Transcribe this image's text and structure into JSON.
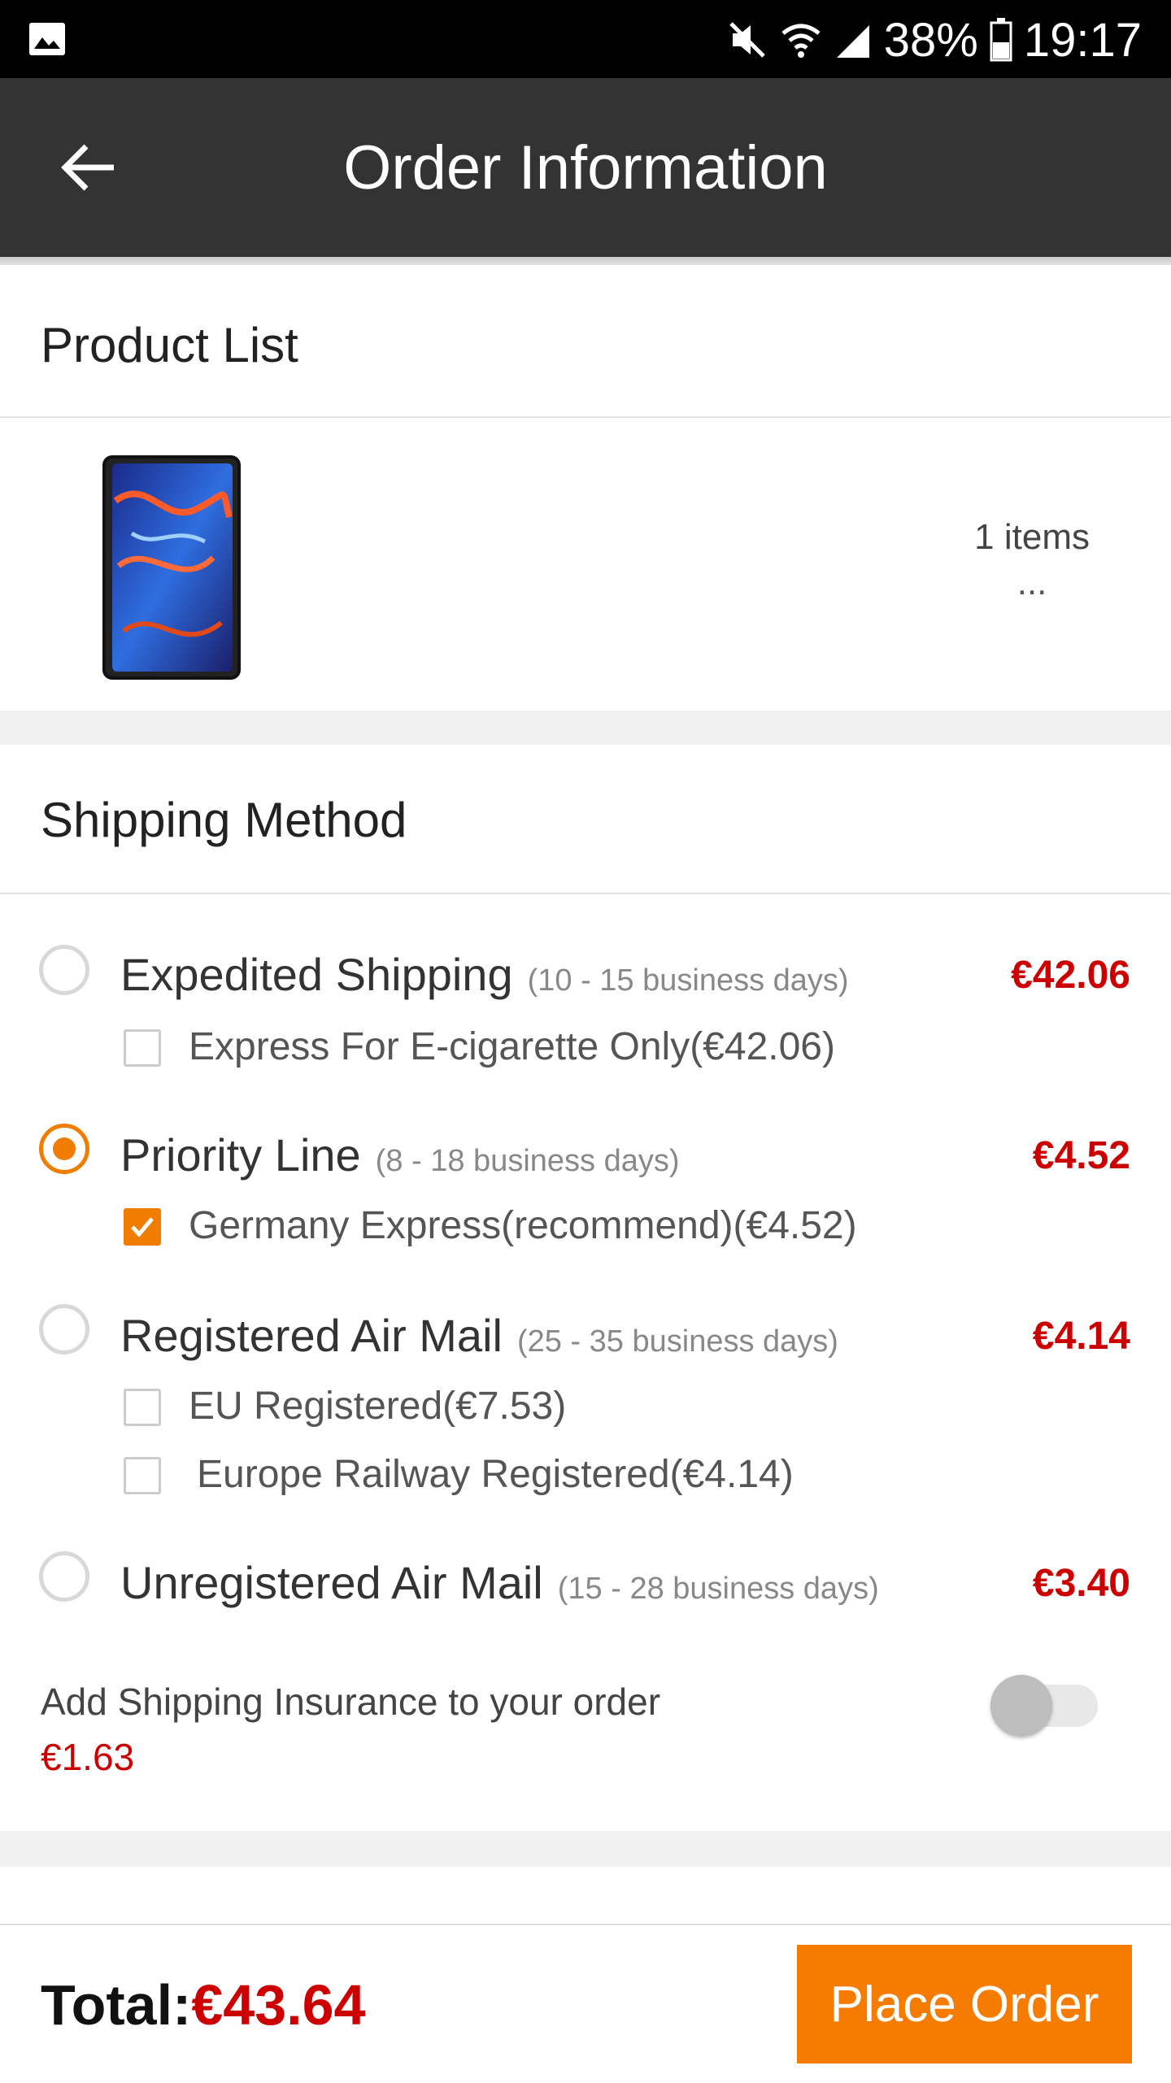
{
  "status_bar": {
    "battery": "38%",
    "time": "19:17",
    "icons": [
      "gallery-icon",
      "mute-icon",
      "wifi-icon",
      "signal-icon",
      "battery-icon"
    ]
  },
  "app_bar": {
    "title": "Order Information",
    "back_icon": "arrow-left-icon"
  },
  "product_list": {
    "title": "Product List",
    "items_count": "1 items",
    "more": "..."
  },
  "shipping": {
    "title": "Shipping Method",
    "options": [
      {
        "name": "Expedited Shipping",
        "days": "(10 - 15 business days)",
        "price": "€42.06",
        "selected": false,
        "sub_options": [
          {
            "label": "Express For E-cigarette Only(€42.06)",
            "checked": false
          }
        ]
      },
      {
        "name": "Priority Line",
        "days": "(8 - 18 business days)",
        "price": "€4.52",
        "selected": true,
        "sub_options": [
          {
            "label": "Germany Express(recommend)(€4.52)",
            "checked": true
          }
        ]
      },
      {
        "name": "Registered Air Mail",
        "days": "(25 - 35 business days)",
        "price": "€4.14",
        "selected": false,
        "sub_options": [
          {
            "label": "EU Registered(€7.53)",
            "checked": false
          },
          {
            "label": "Europe Railway Registered(€4.14)",
            "checked": false
          }
        ]
      },
      {
        "name": "Unregistered Air Mail",
        "days": "(15 - 28 business days)",
        "price": "€3.40",
        "selected": false,
        "sub_options": []
      }
    ],
    "insurance": {
      "label": "Add Shipping Insurance to your order",
      "price": "€1.63",
      "enabled": false
    }
  },
  "footer": {
    "total_label": "Total:",
    "total_amount": "€43.64",
    "place_order": "Place Order"
  },
  "colors": {
    "accent": "#f57c00",
    "price": "#cc0000",
    "app_bar": "#333333"
  }
}
